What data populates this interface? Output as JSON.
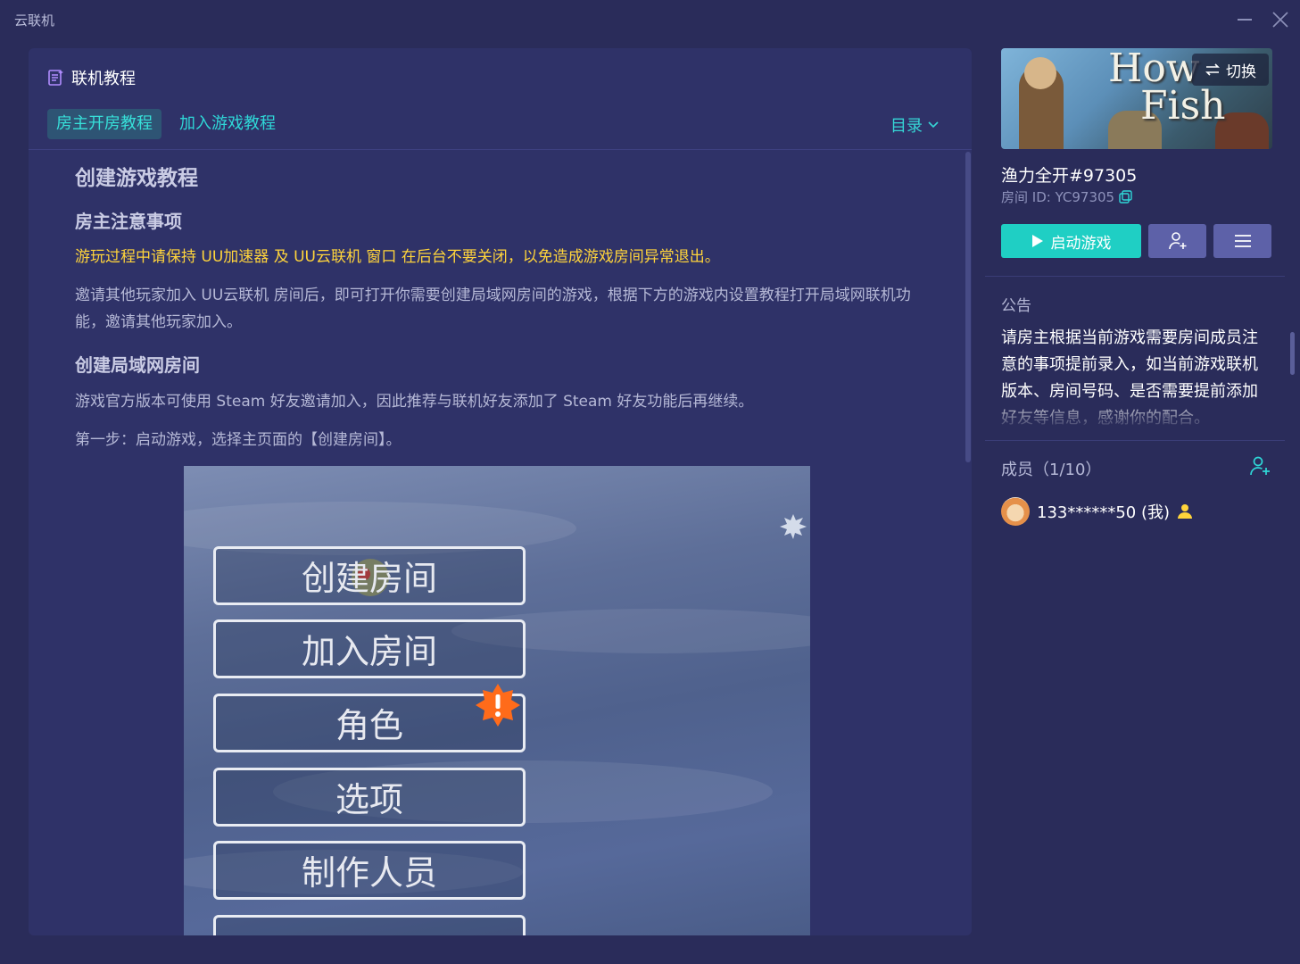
{
  "window": {
    "title": "云联机"
  },
  "tutorial": {
    "header": "联机教程",
    "tabs": [
      {
        "label": "房主开房教程",
        "active": true
      },
      {
        "label": "加入游戏教程",
        "active": false
      }
    ],
    "toc_label": "目录",
    "h1": "创建游戏教程",
    "section1": {
      "title": "房主注意事项",
      "warning": "游玩过程中请保持 UU加速器 及 UU云联机 窗口 在后台不要关闭，以免造成游戏房间异常退出。",
      "body": "邀请其他玩家加入 UU云联机 房间后，即可打开你需要创建局域网房间的游戏，根据下方的游戏内设置教程打开局域网联机功能，邀请其他玩家加入。"
    },
    "section2": {
      "title": "创建局域网房间",
      "body1": "游戏官方版本可使用 Steam 好友邀请加入，因此推荐与联机好友添加了 Steam 好友功能后再继续。",
      "body2": "第一步：启动游戏，选择主页面的【创建房间】。"
    },
    "screenshot_menu": [
      "创建房间",
      "加入房间",
      "角色",
      "选项",
      "制作人员"
    ]
  },
  "room": {
    "cover_title_line1": "How",
    "cover_title_line2": "Fish",
    "switch_label": "切换",
    "game_name": "渔力全开#97305",
    "room_id": "房间 ID: YC97305",
    "start_label": "启动游戏",
    "notice_label": "公告",
    "notice_text": "请房主根据当前游戏需要房间成员注意的事项提前录入，如当前游戏联机版本、房间号码、是否需要提前添加好友等信息，感谢你的配合。",
    "members_label": "成员（1/10）",
    "members": [
      {
        "name": "133******50 (我)",
        "role": "host"
      }
    ]
  },
  "colors": {
    "accent": "#1fcfc4",
    "warning": "#ffd43b",
    "panel": "#2f3268",
    "bg": "#2a2c5a"
  }
}
